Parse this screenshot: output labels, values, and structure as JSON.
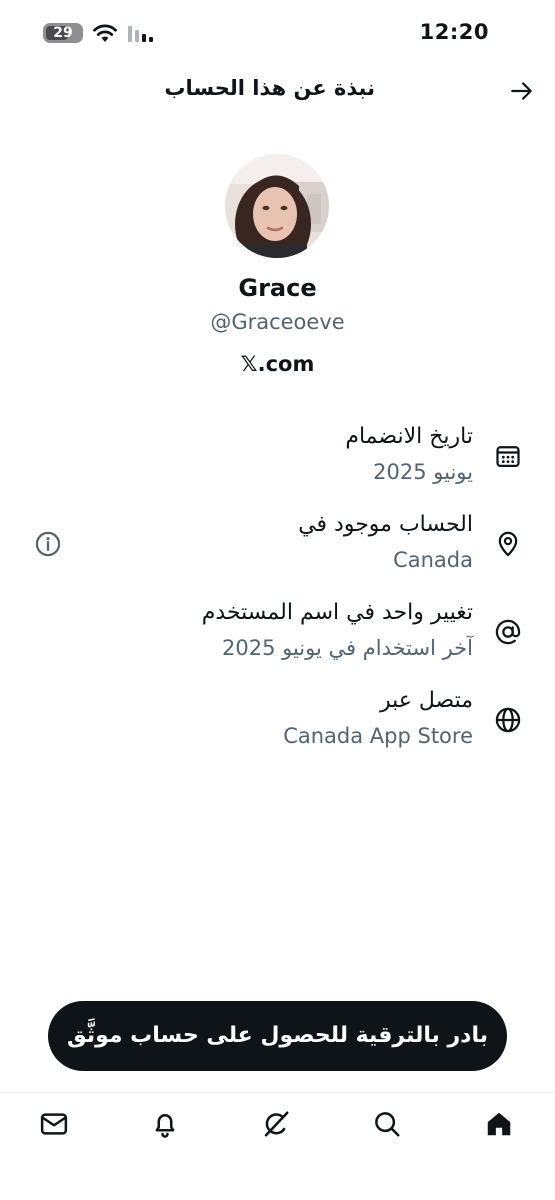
{
  "status_bar": {
    "time": "12:20",
    "battery_level": "29"
  },
  "header": {
    "title": "نبذة عن هذا الحساب"
  },
  "profile": {
    "name": "Grace",
    "handle": "@Graceoeve",
    "site": "𝕏.com"
  },
  "info": {
    "joined": {
      "title": "تاريخ الانضمام",
      "value": "يونيو 2025"
    },
    "location": {
      "title": "الحساب موجود في",
      "value": "Canada"
    },
    "username_change": {
      "title": "تغيير واحد في اسم المستخدم",
      "value": "آخر استخدام في يونيو 2025"
    },
    "connected_via": {
      "title": "متصل عبر",
      "value": "Canada App Store"
    }
  },
  "banner": {
    "label": "بادر بالترقية للحصول على حساب موثَّق"
  },
  "icons": {
    "back": "arrow-right-icon",
    "joined": "calendar-icon",
    "location": "location-pin-icon",
    "username": "at-sign-icon",
    "connected": "globe-icon",
    "info": "info-icon",
    "nav": [
      "mail-icon",
      "bell-icon",
      "grok-icon",
      "search-icon",
      "home-icon"
    ]
  },
  "colors": {
    "text": "#0f1419",
    "secondary": "#536471",
    "banner_bg": "#0f1419"
  }
}
